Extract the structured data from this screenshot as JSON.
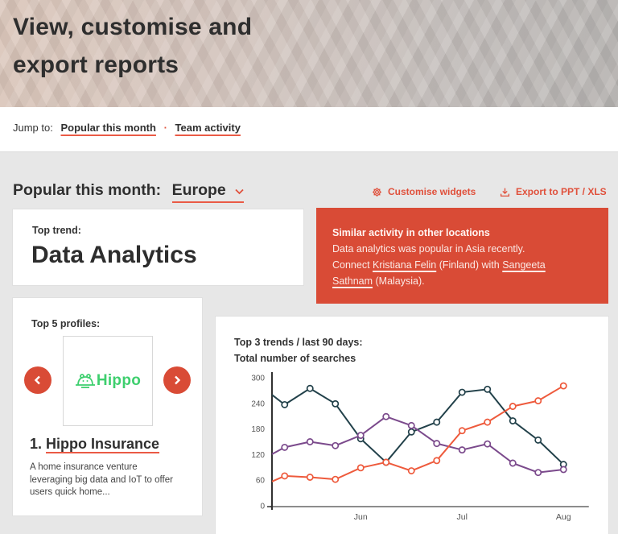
{
  "header": {
    "title_line1": "View, customise and",
    "title_line2": "export reports"
  },
  "jump": {
    "label": "Jump to:",
    "separator": "·",
    "links": [
      {
        "label": "Popular this month"
      },
      {
        "label": "Team activity"
      }
    ]
  },
  "section": {
    "title": "Popular this month:",
    "region": "Europe",
    "region_icon": "chevron-down-icon"
  },
  "actions": {
    "customise": {
      "label": "Customise widgets",
      "icon": "gear-icon"
    },
    "export": {
      "label": "Export to PPT / XLS",
      "icon": "download-icon"
    }
  },
  "top_trend": {
    "label": "Top trend:",
    "value": "Data Analytics"
  },
  "similar": {
    "title": "Similar activity in other locations",
    "line1": "Data analytics was popular in Asia recently.",
    "connect_prefix": "Connect ",
    "person1": "Kristiana Felin",
    "middle": " (Finland) with ",
    "person2": "Sangeeta Sathnam",
    "suffix": " (Malaysia)."
  },
  "profiles": {
    "label": "Top 5 profiles:",
    "prev_icon": "chevron-left-icon",
    "next_icon": "chevron-right-icon",
    "current": {
      "rank": "1.",
      "name": "Hippo Insurance",
      "logo_text": "Hippo",
      "description": "A home insurance venture leveraging big data and IoT to offer users quick home..."
    }
  },
  "colors": {
    "accent": "#e0503b",
    "alert_card": "#d94b36",
    "logo_green": "#3ecf6e"
  },
  "chart_data": {
    "type": "line",
    "title": "Top 3 trends / last 90 days:",
    "subtitle": "Total number of searches",
    "xlabel": "",
    "ylabel": "",
    "ylim": [
      0,
      300
    ],
    "yticks": [
      0,
      60,
      120,
      180,
      240,
      300
    ],
    "xlim": [
      0,
      12.5
    ],
    "xticks": [
      {
        "label": "Jun",
        "x": 3.5
      },
      {
        "label": "Jul",
        "x": 7.5
      },
      {
        "label": "Aug",
        "x": 11.5
      }
    ],
    "x": [
      0,
      0.5,
      1.5,
      2.5,
      3.5,
      4.5,
      5.5,
      6.5,
      7.5,
      8.5,
      9.5,
      10.5,
      11.5
    ],
    "grid": false,
    "legend": "none",
    "series": [
      {
        "name": "",
        "color": "#22414a",
        "values": [
          260,
          237,
          275,
          239,
          157,
          102,
          173,
          196,
          266,
          273,
          199,
          154,
          97
        ]
      },
      {
        "name": "",
        "color": "#7b4a8c",
        "values": [
          121,
          137,
          150,
          141,
          165,
          209,
          188,
          146,
          131,
          145,
          100,
          78,
          85
        ]
      },
      {
        "name": "",
        "color": "#ee5a3c",
        "values": [
          57,
          70,
          67,
          62,
          89,
          102,
          82,
          106,
          176,
          196,
          233,
          246,
          281
        ]
      }
    ]
  }
}
